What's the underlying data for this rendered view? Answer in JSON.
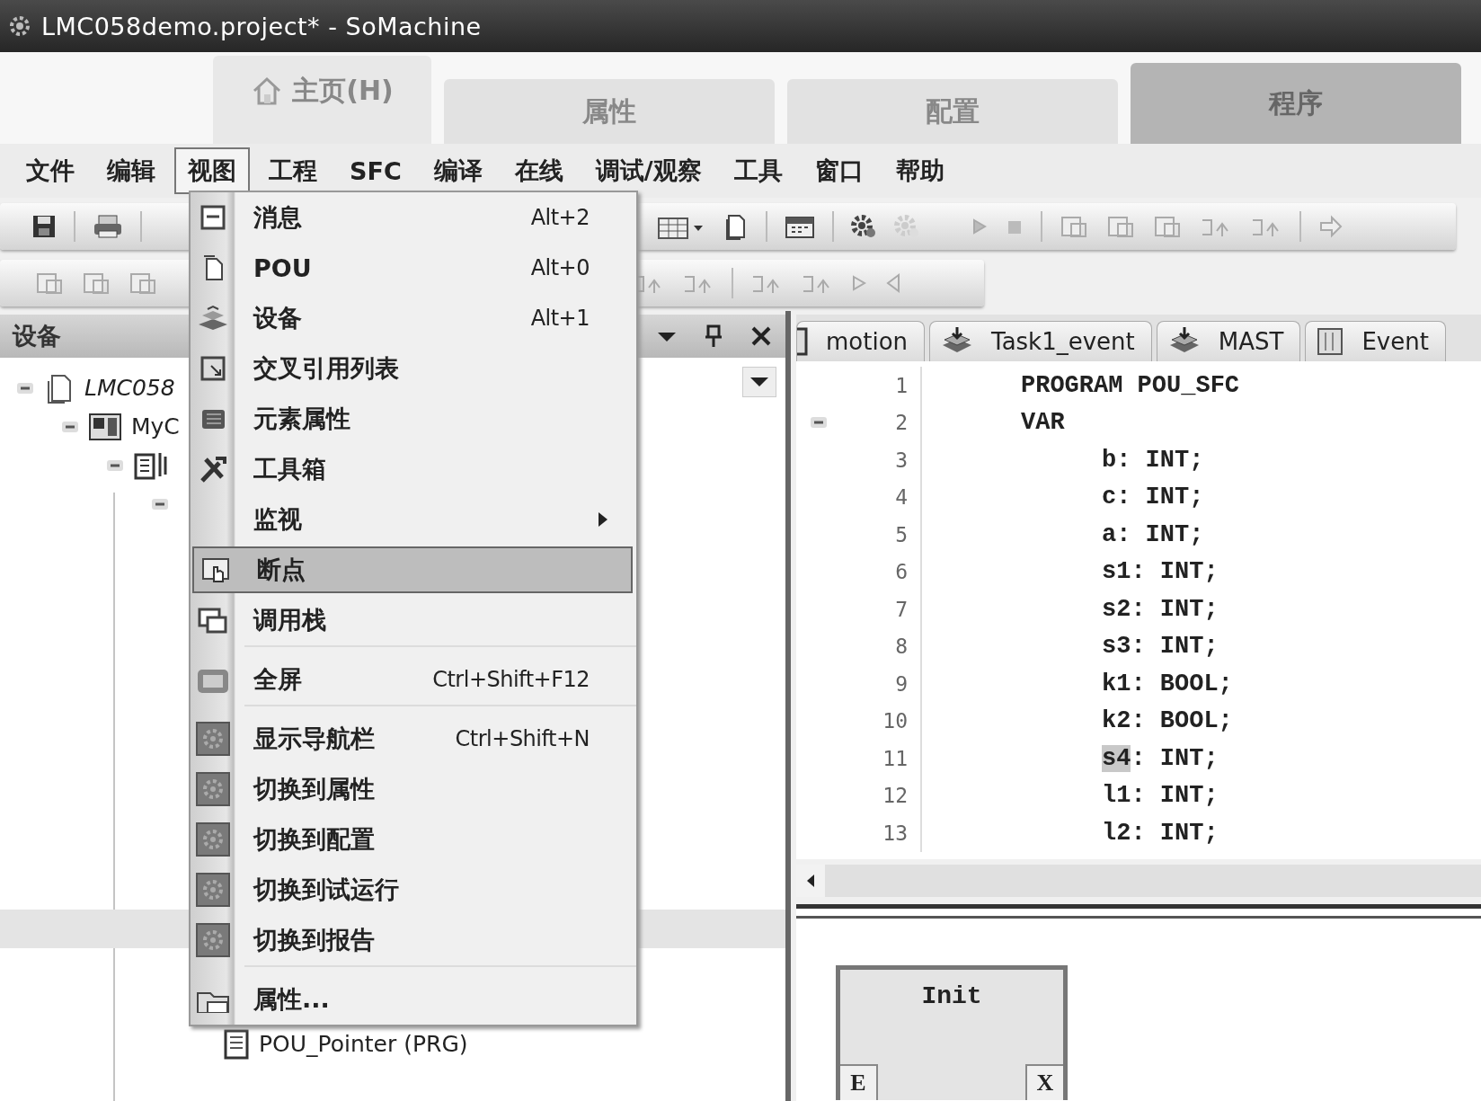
{
  "window": {
    "title": "LMC058demo.project* - SoMachine"
  },
  "ribbon_tabs": [
    {
      "kind": "home",
      "label": "主页(H)",
      "selected": false
    },
    {
      "kind": "section",
      "label": "属性",
      "selected": false
    },
    {
      "kind": "section",
      "label": "配置",
      "selected": false
    },
    {
      "kind": "section",
      "label": "程序",
      "selected": true
    }
  ],
  "menu_bar": [
    {
      "label": "文件",
      "selected": false
    },
    {
      "label": "编辑",
      "selected": false
    },
    {
      "label": "视图",
      "selected": true
    },
    {
      "label": "工程",
      "selected": false
    },
    {
      "label": "SFC",
      "selected": false
    },
    {
      "label": "编译",
      "selected": false
    },
    {
      "label": "在线",
      "selected": false
    },
    {
      "label": "调试/观察",
      "selected": false
    },
    {
      "label": "工具",
      "selected": false
    },
    {
      "label": "窗口",
      "selected": false
    },
    {
      "label": "帮助",
      "selected": false
    }
  ],
  "view_menu": [
    {
      "kind": "command",
      "label": "消息",
      "shortcut": "Alt+2",
      "submenu": false,
      "selected": false
    },
    {
      "kind": "command",
      "label": "POU",
      "shortcut": "Alt+0",
      "submenu": false,
      "selected": false
    },
    {
      "kind": "command",
      "label": "设备",
      "shortcut": "Alt+1",
      "submenu": false,
      "selected": false
    },
    {
      "kind": "command",
      "label": "交叉引用列表",
      "submenu": false,
      "selected": false
    },
    {
      "kind": "command",
      "label": "元素属性",
      "submenu": false,
      "selected": false
    },
    {
      "kind": "command",
      "label": "工具箱",
      "submenu": false,
      "selected": false
    },
    {
      "kind": "command",
      "label": "监视",
      "submenu": true,
      "selected": false
    },
    {
      "kind": "command",
      "label": "断点",
      "submenu": false,
      "selected": true
    },
    {
      "kind": "command",
      "label": "调用栈",
      "submenu": false,
      "selected": false
    },
    {
      "kind": "separator"
    },
    {
      "kind": "command",
      "label": "全屏",
      "shortcut": "Ctrl+Shift+F12",
      "submenu": false,
      "selected": false
    },
    {
      "kind": "separator"
    },
    {
      "kind": "command",
      "label": "显示导航栏",
      "shortcut": "Ctrl+Shift+N",
      "submenu": false,
      "selected": false
    },
    {
      "kind": "command",
      "label": "切换到属性",
      "submenu": false,
      "selected": false
    },
    {
      "kind": "command",
      "label": "切换到配置",
      "submenu": false,
      "selected": false
    },
    {
      "kind": "command",
      "label": "切换到试运行",
      "submenu": false,
      "selected": false
    },
    {
      "kind": "command",
      "label": "切换到报告",
      "submenu": false,
      "selected": false
    },
    {
      "kind": "separator"
    },
    {
      "kind": "command",
      "label": "属性...",
      "submenu": false,
      "selected": false
    }
  ],
  "devices_panel": {
    "title": "设备",
    "tree": [
      {
        "label": "LMC058",
        "expanded": true,
        "selected": false,
        "children": [
          {
            "label": "MyC",
            "expanded": true,
            "selected": false,
            "children": [
              {
                "expanded": true,
                "selected": false,
                "children": [
                  {
                    "expanded": true,
                    "selected": false,
                    "children": [
                      {
                        "selected": true
                      },
                      {
                        "label": "POU_Pointer (PRG)",
                        "selected": false
                      }
                    ]
                  }
                ]
              }
            ]
          }
        ]
      }
    ]
  },
  "editor": {
    "tabs": [
      {
        "label": "motion"
      },
      {
        "label": "Task1_event"
      },
      {
        "label": "MAST"
      },
      {
        "label": "Event"
      }
    ],
    "lines": [
      {
        "number": "1",
        "kind": "header",
        "text": "PROGRAM POU_SFC",
        "foldable": false
      },
      {
        "number": "2",
        "kind": "header",
        "text": "VAR",
        "foldable": true
      },
      {
        "number": "3",
        "kind": "declaration",
        "name": "b:",
        "type": "INT;",
        "highlighted": false,
        "foldable": false
      },
      {
        "number": "4",
        "kind": "declaration",
        "name": "c:",
        "type": "INT;",
        "highlighted": false,
        "foldable": false
      },
      {
        "number": "5",
        "kind": "declaration",
        "name": "a:",
        "type": "INT;",
        "highlighted": false,
        "foldable": false
      },
      {
        "number": "6",
        "kind": "declaration",
        "name": "s1:",
        "type": "INT;",
        "highlighted": false,
        "foldable": false
      },
      {
        "number": "7",
        "kind": "declaration",
        "name": "s2:",
        "type": "INT;",
        "highlighted": false,
        "foldable": false
      },
      {
        "number": "8",
        "kind": "declaration",
        "name": "s3:",
        "type": "INT;",
        "highlighted": false,
        "foldable": false
      },
      {
        "number": "9",
        "kind": "declaration",
        "name": "k1:",
        "type": "BOOL;",
        "highlighted": false,
        "foldable": false
      },
      {
        "number": "10",
        "kind": "declaration",
        "name": "k2:",
        "type": "BOOL;",
        "highlighted": false,
        "foldable": false
      },
      {
        "number": "11",
        "kind": "declaration",
        "name": "s4",
        "rest": ":",
        "type": "INT;",
        "highlighted": true,
        "foldable": false
      },
      {
        "number": "12",
        "kind": "declaration",
        "name": "l1:",
        "type": "INT;",
        "highlighted": false,
        "foldable": false
      },
      {
        "number": "13",
        "kind": "declaration",
        "name": "l2:",
        "type": "INT;",
        "highlighted": false,
        "foldable": false
      }
    ],
    "sfc_step": {
      "name": "Init",
      "entry": "E",
      "exit": "X"
    }
  }
}
